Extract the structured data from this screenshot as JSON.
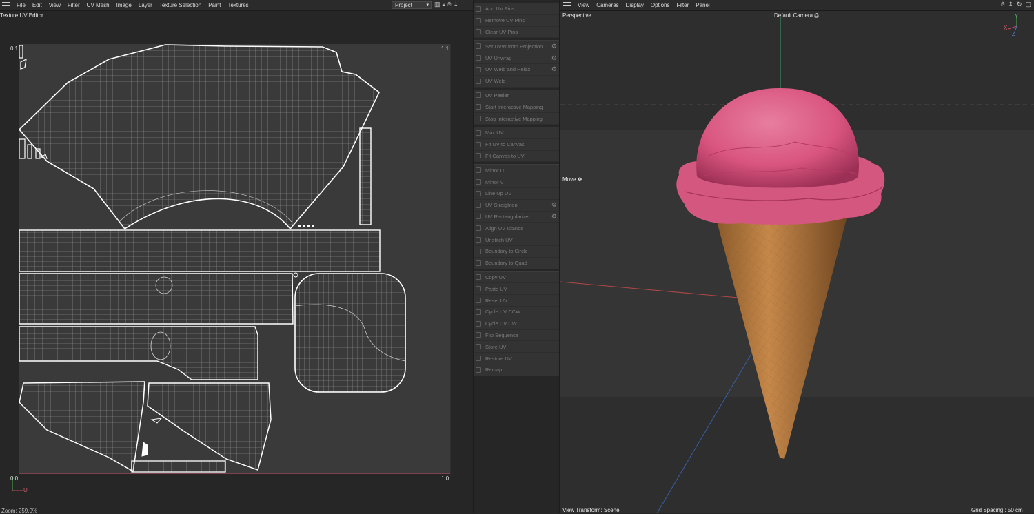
{
  "uv_editor": {
    "menu": [
      "File",
      "Edit",
      "View",
      "Filter",
      "UV Mesh",
      "Image",
      "Layer",
      "Texture Selection",
      "Paint",
      "Textures"
    ],
    "project_select": "Project",
    "title": "Texture UV Editor",
    "corners": {
      "top_left": "0,1",
      "top_right": "1,1",
      "bottom_left": "0,0",
      "bottom_right": "1,0"
    },
    "axis_label": "U",
    "zoom": "Zoom: 259.0%"
  },
  "tools": {
    "groups": [
      [
        {
          "label": "Add UV Pins",
          "gear": false
        },
        {
          "label": "Remove UV Pins",
          "gear": false
        },
        {
          "label": "Clear UV Pins",
          "gear": false
        }
      ],
      [
        {
          "label": "Set UVW from Projection",
          "gear": true
        },
        {
          "label": "UV Unwrap",
          "gear": true
        },
        {
          "label": "UV Weld and Relax",
          "gear": true
        },
        {
          "label": "UV Weld",
          "gear": false
        }
      ],
      [
        {
          "label": "UV Peeler",
          "gear": false
        },
        {
          "label": "Start Interactive Mapping",
          "gear": false
        },
        {
          "label": "Stop Interactive Mapping",
          "gear": false
        }
      ],
      [
        {
          "label": "Max UV",
          "gear": false
        },
        {
          "label": "Fit UV to Canvas",
          "gear": false
        },
        {
          "label": "Fit Canvas to UV",
          "gear": false
        }
      ],
      [
        {
          "label": "Mirror U",
          "gear": false
        },
        {
          "label": "Mirror V",
          "gear": false
        },
        {
          "label": "Line Up UV",
          "gear": false
        },
        {
          "label": "UV Straighten",
          "gear": true
        },
        {
          "label": "UV Rectangularize",
          "gear": true
        },
        {
          "label": "Align UV Islands",
          "gear": false
        },
        {
          "label": "Unstitch UV",
          "gear": false
        },
        {
          "label": "Boundary to Circle",
          "gear": false
        },
        {
          "label": "Boundary to Quad",
          "gear": false
        }
      ],
      [
        {
          "label": "Copy UV",
          "gear": false
        },
        {
          "label": "Paste UV",
          "gear": false
        },
        {
          "label": "Reset UV",
          "gear": false
        },
        {
          "label": "Cycle UV CCW",
          "gear": false
        },
        {
          "label": "Cycle UV CW",
          "gear": false
        },
        {
          "label": "Flip Sequence",
          "gear": false
        },
        {
          "label": "Store UV",
          "gear": false
        },
        {
          "label": "Restore UV",
          "gear": false
        },
        {
          "label": "Remap...",
          "gear": false
        }
      ]
    ]
  },
  "viewport": {
    "menu": [
      "View",
      "Cameras",
      "Display",
      "Options",
      "Filter",
      "Panel"
    ],
    "view_name": "Perspective",
    "camera": "Default Camera",
    "tool": "Move",
    "view_transform": "View Transform: Scene",
    "grid_spacing": "Grid Spacing : 50 cm",
    "axes": {
      "x": "X",
      "y": "Y",
      "z": "Z"
    },
    "colors": {
      "scoop": "#d9557f",
      "cone": "#c6884a"
    }
  }
}
